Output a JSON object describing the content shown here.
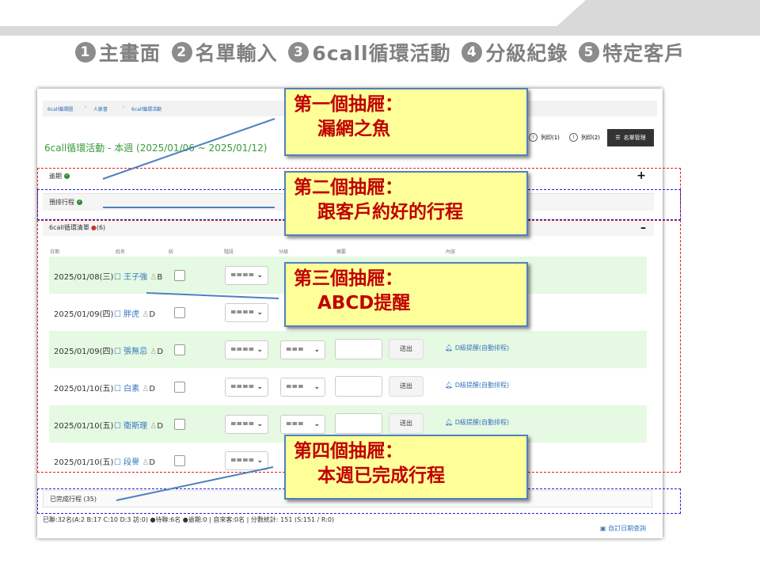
{
  "steps": [
    {
      "num": "1",
      "label": "主畫面"
    },
    {
      "num": "2",
      "label": "名單輸入"
    },
    {
      "num": "3",
      "label": "6call循環活動"
    },
    {
      "num": "4",
      "label": "分級紀錄"
    },
    {
      "num": "5",
      "label": "特定客戶"
    }
  ],
  "breadcrumb": [
    "6call循環圖",
    "人脈書",
    "6call循環活動"
  ],
  "page_title": "6call循環活動 - 本週 (2025/01/06 ~ 2025/01/12)",
  "buttons": {
    "print1": "列印(1)",
    "print2": "列印(2)",
    "list_manage": "名單管理"
  },
  "sections": {
    "overdue": "逾期",
    "scheduled": "預排行程",
    "cycle_list": "6call循環清單",
    "cycle_count": "(6)",
    "done": "已完成行程 (35)"
  },
  "columns": [
    "日期",
    "姓名",
    "紡",
    "階段",
    "分級",
    "摘要",
    "內容"
  ],
  "rows": [
    {
      "date": "2025/01/08(三)",
      "name": "王子強",
      "grade": "B",
      "sel1": "====",
      "sel2": "===",
      "reminder": ""
    },
    {
      "date": "2025/01/09(四)",
      "name": "胖虎",
      "grade": "D",
      "sel1": "====",
      "sel2": "===",
      "reminder": ""
    },
    {
      "date": "2025/01/09(四)",
      "name": "張無忌",
      "grade": "D",
      "sel1": "====",
      "sel2": "===",
      "reminder": "D級提醒(自動排程)"
    },
    {
      "date": "2025/01/10(五)",
      "name": "白素",
      "grade": "D",
      "sel1": "====",
      "sel2": "===",
      "reminder": "D級提醒(自動排程)"
    },
    {
      "date": "2025/01/10(五)",
      "name": "衛斯理",
      "grade": "D",
      "sel1": "====",
      "sel2": "===",
      "reminder": "D級提醒(自動排程)"
    },
    {
      "date": "2025/01/10(五)",
      "name": "段譽",
      "grade": "D",
      "sel1": "====",
      "sel2": "===",
      "reminder": ""
    }
  ],
  "send_label": "送出",
  "status_bar": "已聯:32名(A:2 B:17 C:10 D:3 訪:0) ●待聯:6名 ●逾期:0 | 自來客:0名 | 分數統計: 151 (S:151 / R:0)",
  "calendar_link": "自訂日期查詢",
  "callouts": [
    {
      "line1": "第一個抽屜：",
      "line2": "漏網之魚"
    },
    {
      "line1": "第二個抽屜：",
      "line2": "跟客戶約好的行程"
    },
    {
      "line1": "第三個抽屜：",
      "line2": "ABCD提醒"
    },
    {
      "line1": "第四個抽屜：",
      "line2": "本週已完成行程"
    }
  ],
  "colors": {
    "callout_bg": "#ffff99",
    "callout_text": "#c00000",
    "callout_border": "#4f81bd",
    "row_green": "#e6f9e2",
    "title_green": "#3c9a3c",
    "link_blue": "#3777bf"
  }
}
